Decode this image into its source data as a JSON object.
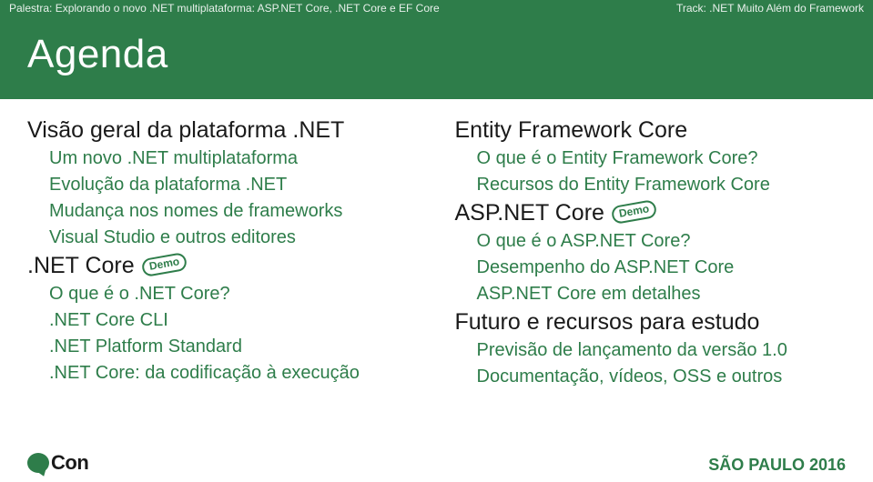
{
  "header": {
    "left": "Palestra: Explorando o novo .NET multiplataforma: ASP.NET Core, .NET Core e EF Core",
    "right": "Track: .NET Muito Além do Framework"
  },
  "title": "Agenda",
  "left_col": {
    "s1": {
      "title": "Visão geral da plataforma .NET",
      "items": [
        "Um novo .NET multiplataforma",
        "Evolução da plataforma .NET",
        "Mudança nos nomes de frameworks",
        "Visual Studio e outros editores"
      ]
    },
    "s2": {
      "title": ".NET Core",
      "badge": "Demo",
      "items": [
        "O que é o .NET Core?",
        ".NET Core CLI",
        ".NET Platform Standard",
        ".NET Core: da codificação à execução"
      ]
    }
  },
  "right_col": {
    "s1": {
      "title": "Entity Framework Core",
      "items": [
        "O que é o Entity Framework Core?",
        "Recursos do Entity Framework Core"
      ]
    },
    "s2": {
      "title": "ASP.NET Core",
      "badge": "Demo",
      "items": [
        "O que é o ASP.NET Core?",
        "Desempenho do ASP.NET Core",
        "ASP.NET Core em detalhes"
      ]
    },
    "s3": {
      "title": "Futuro e recursos para estudo",
      "items": [
        "Previsão de lançamento da versão 1.0",
        "Documentação, vídeos, OSS e outros"
      ]
    }
  },
  "footer": {
    "logo_text": "Con",
    "right": "SÃO PAULO 2016"
  }
}
